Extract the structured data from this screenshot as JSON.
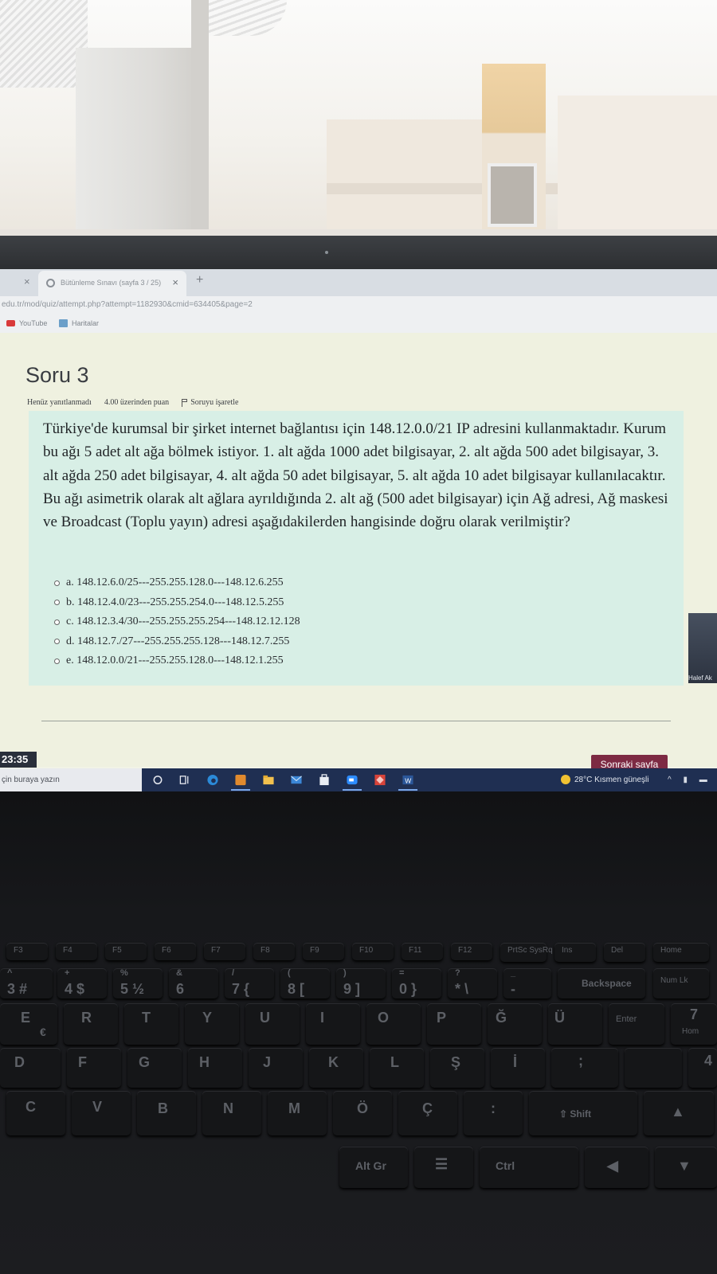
{
  "browser": {
    "tab_title": "Bütünleme Sınavı (sayfa 3 / 25)",
    "tab_close": "×",
    "new_tab": "+",
    "url": "edu.tr/mod/quiz/attempt.php?attempt=1182930&cmid=634405&page=2",
    "bookmarks": [
      "YouTube",
      "Haritalar"
    ]
  },
  "quiz": {
    "title": "Soru 3",
    "status": "Henüz yanıtlanmadı",
    "points": "4.00 üzerinden puan",
    "flag_label": "Soruyu işaretle",
    "question": "Türkiye'de kurumsal bir şirket internet bağlantısı için 148.12.0.0/21 IP adresini kullanmaktadır. Kurum bu ağı 5 adet alt ağa bölmek istiyor. 1. alt ağda 1000 adet bilgisayar, 2. alt ağda 500 adet bilgisayar, 3. alt ağda 250 adet bilgisayar, 4. alt ağda 50 adet bilgisayar, 5. alt ağda 10 adet bilgisayar kullanılacaktır. Bu ağı asimetrik olarak alt ağlara ayrıldığında 2. alt ağ (500 adet bilgisayar) için Ağ adresi, Ağ maskesi ve Broadcast (Toplu yayın) adresi aşağıdakilerden hangisinde doğru olarak verilmiştir?",
    "answers": [
      "a. 148.12.6.0/25---255.255.128.0---148.12.6.255",
      "b. 148.12.4.0/23---255.255.254.0---148.12.5.255",
      "c. 148.12.3.4/30---255.255.255.254---148.12.12.128",
      "d. 148.12.7./27---255.255.255.128---148.12.7.255",
      "e. 148.12.0.0/21---255.255.128.0---148.12.1.255"
    ],
    "timer": "23:35",
    "next_button": "Sonraki sayfa"
  },
  "webcam": {
    "name": "Halef Ak"
  },
  "taskbar": {
    "search_placeholder": "çin buraya yazın",
    "weather": "28°C  Kısmen güneşli",
    "tray": "^ ▮ ▬ ◢",
    "icons": [
      "search-circle-icon",
      "task-view-icon",
      "edge-icon",
      "app-icon",
      "file-explorer-icon",
      "mail-icon",
      "store-icon",
      "zoom-icon",
      "anydesk-icon",
      "word-icon"
    ]
  },
  "keyboard": {
    "fn_row": [
      "F3",
      "F4",
      "F5",
      "F6",
      "F7",
      "F8",
      "F9",
      "F10",
      "F11",
      "F12",
      "PrtSc SysRq",
      "Ins",
      "Del",
      "Home"
    ],
    "num_row": [
      "3 #",
      "4 $",
      "5 ½",
      "6",
      "7 {",
      "8 [",
      "9 ]",
      "0 }",
      "* \\",
      "-",
      "",
      "Backspace",
      "Num Lk"
    ],
    "num_row_top": [
      "^",
      "+",
      "%",
      "&",
      "/",
      "(",
      ")",
      "=",
      "?",
      "_"
    ],
    "row_q": [
      "E",
      "R",
      "T",
      "Y",
      "U",
      "I",
      "O",
      "P",
      "Ğ",
      "Ü",
      "Enter",
      "7"
    ],
    "row_a": [
      "D",
      "F",
      "G",
      "H",
      "J",
      "K",
      "L",
      "Ş",
      "İ",
      ";",
      "",
      "4"
    ],
    "row_z": [
      "C",
      "V",
      "B",
      "N",
      "M",
      "Ö",
      "Ç",
      ":",
      "⇧ Shift",
      "▲"
    ],
    "bottom": [
      "Alt Gr",
      "☰",
      "Ctrl",
      "◀",
      "▼"
    ],
    "extras": {
      "euro": "€",
      "home": "Hom"
    }
  }
}
